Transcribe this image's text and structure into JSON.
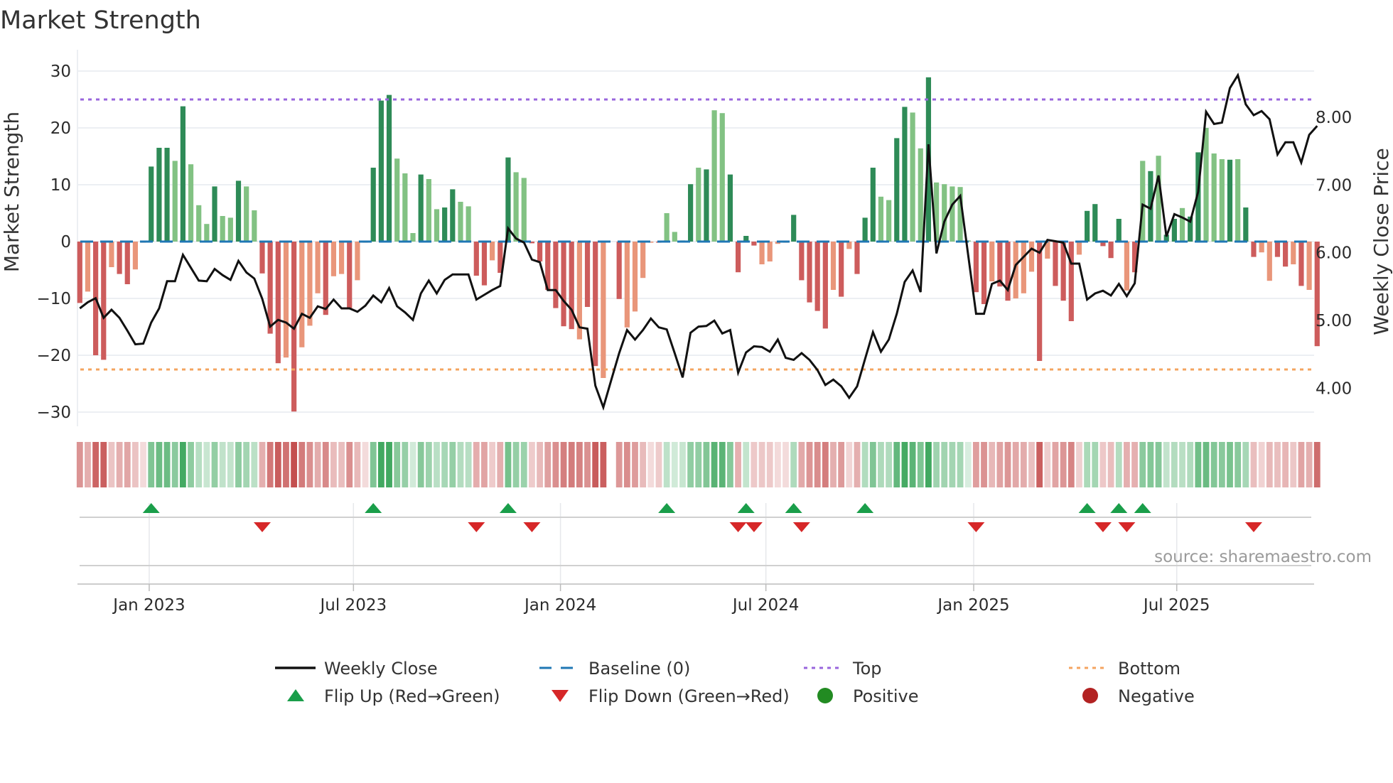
{
  "chart_data": {
    "type": "bar",
    "title": "Market Strength",
    "ylabel": "Market Strength",
    "y2label": "Weekly Close Price",
    "xlabel": "",
    "ylim": [
      -32.5,
      32.5
    ],
    "y2lim": [
      3.44,
      8.89
    ],
    "yticks": [
      30,
      20,
      10,
      0,
      -10,
      -20,
      -30
    ],
    "ytick_labels": [
      "30",
      "20",
      "10",
      "0",
      "−10",
      "−20",
      "−30"
    ],
    "y2ticks": [
      8,
      7,
      6,
      5,
      4
    ],
    "y2tick_labels": [
      "8.00",
      "7.00",
      "6.00",
      "5.00",
      "4.00"
    ],
    "x_unit": "week index",
    "x_ticks": [
      {
        "label": "Jan 2023",
        "week": 8.75
      },
      {
        "label": "Jul 2023",
        "week": 34.5
      },
      {
        "label": "Jan 2024",
        "week": 60.6
      },
      {
        "label": "Jul 2024",
        "week": 86.5
      },
      {
        "label": "Jan 2025",
        "week": 112.7
      },
      {
        "label": "Jul 2025",
        "week": 138.3
      }
    ],
    "grid": true,
    "top_level": 25,
    "bottom_level": -22.5,
    "baseline": 0,
    "strength": [
      -10.8,
      -8.8,
      -20,
      -20.8,
      -4.5,
      -5.7,
      -7.5,
      -4.9,
      -0.2,
      13.2,
      16.5,
      16.5,
      14.2,
      23.8,
      13.6,
      6.4,
      3.1,
      9.7,
      4.5,
      4.2,
      10.7,
      9.7,
      5.5,
      -5.6,
      -16.2,
      -21.4,
      -20.4,
      -29.9,
      -18.6,
      -14.8,
      -9.1,
      -12.9,
      -6.1,
      -5.7,
      -11.7,
      -6.8,
      -0.2,
      13.0,
      24.8,
      25.8,
      14.6,
      12.0,
      1.5,
      11.8,
      11.0,
      5.7,
      6.0,
      9.2,
      7.0,
      6.2,
      -6.0,
      -7.7,
      -3.3,
      -5.5,
      14.8,
      12.2,
      11.2,
      -0.3,
      -3.5,
      -8.5,
      -11.7,
      -14.9,
      -15.4,
      -17.2,
      -11.5,
      -21.9,
      -24.0,
      null,
      -10.1,
      -15.1,
      -12.3,
      -6.4,
      -0.2,
      -0.2,
      5.0,
      1.7,
      0.2,
      10.1,
      13.0,
      12.7,
      23.1,
      22.6,
      11.8,
      -5.4,
      1.0,
      -0.7,
      -4.0,
      -3.5,
      -0.4,
      -0.2,
      4.7,
      -6.8,
      -10.7,
      -12.2,
      -15.3,
      -8.5,
      -9.7,
      -1.3,
      -5.7,
      4.2,
      13.0,
      7.9,
      7.3,
      18.2,
      23.7,
      22.7,
      16.4,
      28.9,
      10.4,
      10.1,
      9.7,
      9.6,
      0.2,
      -8.9,
      -11.0,
      -7.0,
      -7.9,
      -10.4,
      -10.0,
      -9.1,
      -5.3,
      -21.0,
      -3.0,
      -7.8,
      -10.4,
      -14.0,
      -2.3,
      5.4,
      6.6,
      -0.8,
      -2.9,
      4.0,
      -8.6,
      -5.4,
      14.2,
      12.4,
      15.1,
      1.2,
      4.0,
      5.9,
      4.4,
      15.7,
      20.0,
      15.5,
      14.5,
      14.4,
      14.5,
      6.0,
      -2.7,
      -1.9,
      -6.9,
      -2.7,
      -4.4,
      -4.0,
      -7.8,
      -8.5,
      -18.4
    ],
    "shade": "SsSSsSSssSSSwSwwwSwwSwwSSSsSsssSssSssSSSwwwSwwSSwwSSsSSwwSSSSSSsSSxsSssssSwwSSwSwwSSSSssssSSSSSsSsSSSwwSSwwSwwwwwSSsSSsssSsSSSsSSSSSsSwSwSSwSSwwwSwSSssSSsSsSS",
    "weekly_close": [
      5.18,
      5.27,
      5.33,
      5.04,
      5.16,
      5.04,
      4.85,
      4.65,
      4.66,
      4.97,
      5.18,
      5.58,
      5.58,
      5.97,
      5.78,
      5.59,
      5.58,
      5.76,
      5.67,
      5.6,
      5.88,
      5.71,
      5.62,
      5.32,
      4.91,
      5.01,
      4.97,
      4.88,
      5.1,
      5.04,
      5.21,
      5.17,
      5.31,
      5.18,
      5.18,
      5.13,
      5.22,
      5.37,
      5.27,
      5.48,
      5.21,
      5.12,
      5.01,
      5.4,
      5.59,
      5.4,
      5.6,
      5.68,
      5.68,
      5.68,
      5.31,
      5.38,
      5.45,
      5.51,
      6.36,
      6.21,
      6.15,
      5.9,
      5.86,
      5.45,
      5.45,
      5.29,
      5.16,
      4.9,
      4.88,
      4.04,
      3.72,
      4.12,
      4.52,
      4.86,
      4.72,
      4.86,
      5.03,
      4.9,
      4.87,
      4.52,
      4.16,
      4.82,
      4.91,
      4.92,
      5.0,
      4.81,
      4.86,
      4.23,
      4.53,
      4.62,
      4.61,
      4.54,
      4.72,
      4.45,
      4.42,
      4.52,
      4.42,
      4.27,
      4.05,
      4.13,
      4.03,
      3.86,
      4.03,
      4.43,
      4.83,
      4.54,
      4.72,
      5.1,
      5.57,
      5.74,
      5.42,
      7.6,
      5.99,
      6.46,
      6.71,
      6.84,
      5.97,
      5.1,
      5.1,
      5.54,
      5.59,
      5.45,
      5.82,
      5.94,
      6.06,
      6.0,
      6.19,
      6.17,
      6.15,
      5.84,
      5.84,
      5.31,
      5.4,
      5.44,
      5.37,
      5.54,
      5.36,
      5.55,
      6.71,
      6.65,
      7.14,
      6.24,
      6.57,
      6.52,
      6.46,
      6.9,
      8.08,
      7.9,
      7.92,
      8.43,
      8.62,
      8.19,
      8.03,
      8.09,
      7.97,
      7.45,
      7.63,
      7.63,
      7.33,
      7.74,
      7.87
    ],
    "flip_up_weeks": [
      9,
      37,
      54,
      74,
      84,
      90,
      99,
      127,
      131,
      134
    ],
    "flip_down_weeks": [
      23,
      50,
      57,
      83,
      85,
      91,
      113,
      129,
      132,
      148
    ],
    "legend_placement": "bottom-center",
    "legend": [
      {
        "label": "Weekly Close",
        "kind": "line"
      },
      {
        "label": "Baseline (0)",
        "kind": "dashed"
      },
      {
        "label": "Top",
        "kind": "dotted-purple"
      },
      {
        "label": "Bottom",
        "kind": "dotted-orange"
      },
      {
        "label": "Flip Up (Red→Green)",
        "kind": "triangle-up"
      },
      {
        "label": "Flip Down (Green→Red)",
        "kind": "triangle-down"
      },
      {
        "label": "Positive",
        "kind": "circle-green"
      },
      {
        "label": "Negative",
        "kind": "circle-red"
      }
    ],
    "source": "source: sharemaestro.com"
  },
  "colors": {
    "pos_strong": "#2e8b57",
    "pos_weak": "#82c283",
    "neg_strong": "#cd5c5c",
    "neg_weak": "#e9967a",
    "price_line": "#111111",
    "baseline": "#1f77b4",
    "top": "#9966dd",
    "bottom": "#f4a460",
    "flip_up": "#1a9e4a",
    "flip_down": "#d62728",
    "positive": "#228b22",
    "negative": "#b22222",
    "grid": "#eceff3"
  }
}
